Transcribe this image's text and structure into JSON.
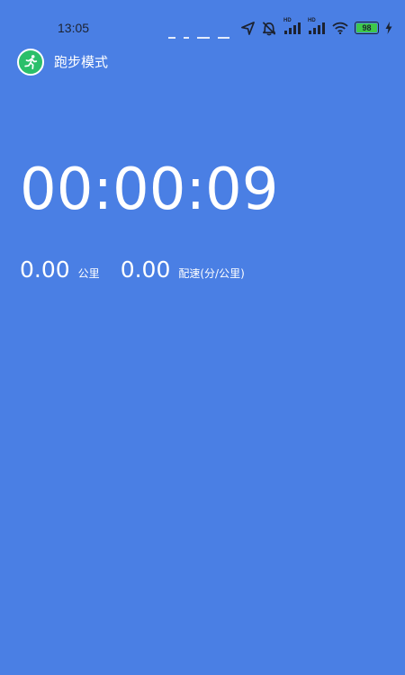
{
  "status_bar": {
    "time": "13:05",
    "battery_level": "98",
    "hd_label_1": "HD",
    "hd_label_2": "HD",
    "icons": [
      "location-arrow-icon",
      "alarm-off-icon",
      "signal-1-icon",
      "signal-2-icon",
      "wifi-icon",
      "battery-icon",
      "charging-bolt-icon"
    ]
  },
  "app_bar": {
    "icon": "running-person-icon",
    "title": "跑步模式"
  },
  "timer": {
    "elapsed": "00:00:09"
  },
  "stats": {
    "distance_value": "0.00",
    "distance_unit": "公里",
    "pace_value": "0.00",
    "pace_unit": "配速(分/公里)"
  },
  "colors": {
    "background": "#4a7fe4",
    "logo": "#2bbf6a",
    "battery": "#3ec84b",
    "text": "#ffffff"
  }
}
